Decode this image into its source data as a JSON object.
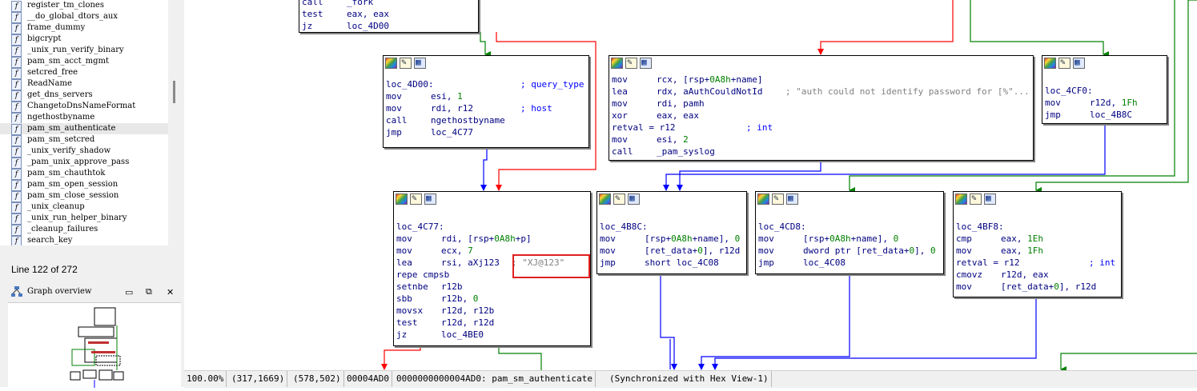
{
  "functions": [
    "register_tm_clones",
    "__do_global_dtors_aux",
    "frame_dummy",
    "bigcrypt",
    "_unix_run_verify_binary",
    "pam_sm_acct_mgmt",
    "setcred_free",
    "ReadName",
    "get_dns_servers",
    "ChangetoDnsNameFormat",
    "ngethostbyname",
    "pam_sm_authenticate",
    "pam_sm_setcred",
    "_unix_verify_shadow",
    "_pam_unix_approve_pass",
    "pam_sm_chauthtok",
    "pam_sm_open_session",
    "pam_sm_close_session",
    "_unix_cleanup",
    "_unix_run_helper_binary",
    "_cleanup_failures",
    "search_key"
  ],
  "selected_function": "pam_sm_authenticate",
  "line_count": "Line 122 of 272",
  "overview": {
    "title": "Graph overview"
  },
  "nodes": {
    "top": {
      "lines": [
        {
          "m": "call",
          "o": "_fork"
        },
        {
          "m": "test",
          "o": "eax, eax"
        },
        {
          "m": "jz",
          "o": "loc_4D00"
        }
      ]
    },
    "n4d00": {
      "label": "loc_4D00:",
      "label_comment": "; query_type",
      "lines": [
        {
          "m": "mov",
          "o": "esi, 1"
        },
        {
          "m": "mov",
          "o": "rdi, r12",
          "c": "; host"
        },
        {
          "m": "call",
          "o": "ngethostbyname"
        },
        {
          "m": "jmp",
          "o": "loc_4C77"
        }
      ]
    },
    "nauth": {
      "lines": [
        {
          "m": "mov",
          "o": "rcx, [rsp+0A8h+name]"
        },
        {
          "m": "lea",
          "o": "rdx, aAuthCouldNotId",
          "c": "; \"auth could not identify password for [%\"..."
        },
        {
          "m": "mov",
          "o": "rdi, pamh"
        },
        {
          "m": "xor",
          "o": "eax, eax"
        },
        {
          "m": "retval = r12",
          "o": "",
          "c": "; int"
        },
        {
          "m": "mov",
          "o": "esi, 2"
        },
        {
          "m": "call",
          "o": "_pam_syslog"
        }
      ]
    },
    "n4cf0": {
      "label": "loc_4CF0:",
      "lines": [
        {
          "m": "mov",
          "o": "r12d, 1Fh"
        },
        {
          "m": "jmp",
          "o": "loc_4B8C"
        }
      ]
    },
    "n4c77": {
      "label": "loc_4C77:",
      "lines": [
        {
          "m": "mov",
          "o": "rdi, [rsp+0A8h+p]"
        },
        {
          "m": "mov",
          "o": "ecx, 7"
        },
        {
          "m": "lea",
          "o": "rsi, aXj123",
          "c": "; \"XJ@123\""
        },
        {
          "m": "repe cmpsb",
          "o": ""
        },
        {
          "m": "setnbe",
          "o": "r12b"
        },
        {
          "m": "sbb",
          "o": "r12b, 0"
        },
        {
          "m": "movsx",
          "o": "r12d, r12b"
        },
        {
          "m": "test",
          "o": "r12d, r12d"
        },
        {
          "m": "jz",
          "o": "loc_4BE0"
        }
      ]
    },
    "n4b8c": {
      "label": "loc_4B8C:",
      "lines": [
        {
          "m": "mov",
          "o": "[rsp+0A8h+name], 0"
        },
        {
          "m": "mov",
          "o": "[ret_data+0], r12d"
        },
        {
          "m": "jmp",
          "o": "short loc_4C08"
        }
      ]
    },
    "n4cd8": {
      "label": "loc_4CD8:",
      "lines": [
        {
          "m": "mov",
          "o": "[rsp+0A8h+name], 0"
        },
        {
          "m": "mov",
          "o": "dword ptr [ret_data+0], 0"
        },
        {
          "m": "jmp",
          "o": "loc_4C08"
        }
      ]
    },
    "n4bf8": {
      "label": "loc_4BF8:",
      "lines": [
        {
          "m": "cmp",
          "o": "eax, 1Eh"
        },
        {
          "m": "mov",
          "o": "eax, 1Fh"
        },
        {
          "m": "retval = r12",
          "o": "",
          "c": "; int"
        },
        {
          "m": "cmovz",
          "o": "r12d, eax"
        },
        {
          "m": "mov",
          "o": "[ret_data+0], r12d"
        }
      ]
    }
  },
  "status": [
    "100.00%",
    "(317,1669)",
    "(578,502)",
    "00004AD0",
    "0000000000004AD0: pam_sm_authenticate",
    "(Synchronized with Hex View-1)"
  ],
  "colors": {
    "true_edge": "#008000",
    "false_edge": "#ff0000",
    "jump_edge": "#0000ff",
    "highlight": "#e02020"
  }
}
